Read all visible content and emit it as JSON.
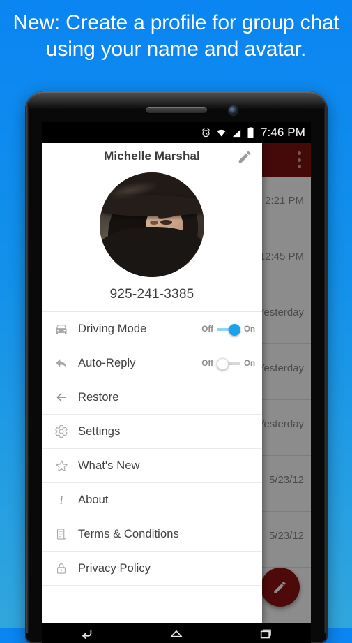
{
  "headline": {
    "text": "New: Create a profile for group chat using your name and avatar."
  },
  "colors": {
    "background_top": "#0a85f2",
    "background_bottom": "#31a6dd",
    "action_bar": "#7d1111",
    "fab": "#8f1313",
    "toggle_on": "#1aa3ec",
    "toggle_track_on": "#8fd4f7",
    "toggle_off": "#fdfdfd"
  },
  "status_bar": {
    "time": "7:46 PM",
    "icons": [
      "alarm-icon",
      "wifi-icon",
      "signal-icon",
      "battery-icon"
    ]
  },
  "behind_app": {
    "overflow_menu": "overflow-menu-icon",
    "fab_icon": "compose-pencil-icon",
    "messages": [
      {
        "time": "2:21 PM"
      },
      {
        "time": "12:45 PM"
      },
      {
        "time": "Yesterday"
      },
      {
        "time": "Yesterday"
      },
      {
        "time": "Yesterday"
      },
      {
        "time": "5/23/12"
      },
      {
        "time": "5/23/12"
      }
    ]
  },
  "drawer": {
    "profile": {
      "name": "Michelle Marshal",
      "edit_icon": "pencil-edit-icon",
      "avatar_icon": "user-avatar-photo",
      "phone_number": "925-241-3385"
    },
    "toggle_labels": {
      "off": "Off",
      "on": "On"
    },
    "items": [
      {
        "label": "Driving Mode",
        "icon": "car-icon",
        "toggle": "on"
      },
      {
        "label": "Auto-Reply",
        "icon": "reply-arrow-icon",
        "toggle": "off"
      },
      {
        "label": "Restore",
        "icon": "arrow-left-icon",
        "toggle": null
      },
      {
        "label": "Settings",
        "icon": "gear-icon",
        "toggle": null
      },
      {
        "label": "What's New",
        "icon": "star-icon",
        "toggle": null
      },
      {
        "label": "About",
        "icon": "info-icon",
        "toggle": null
      },
      {
        "label": "Terms & Conditions",
        "icon": "document-icon",
        "toggle": null
      },
      {
        "label": "Privacy Policy",
        "icon": "lock-icon",
        "toggle": null
      }
    ]
  },
  "nav_bar": {
    "buttons": [
      "back-icon",
      "home-icon",
      "recents-icon"
    ]
  }
}
